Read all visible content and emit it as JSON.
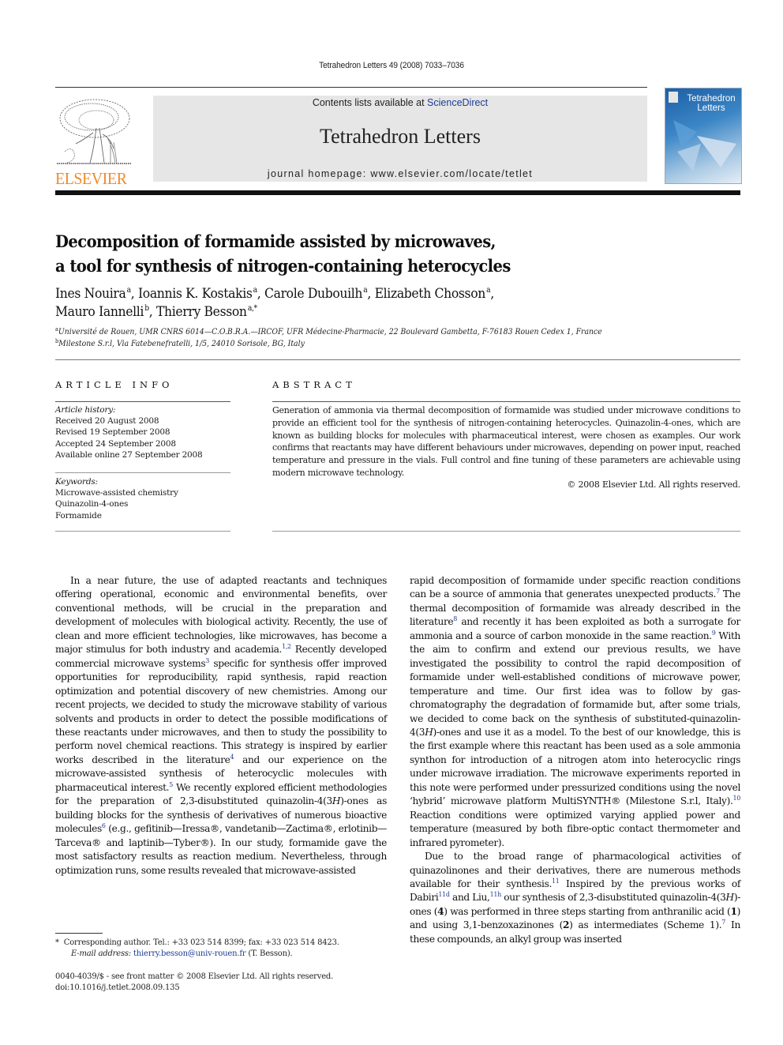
{
  "running_head": "Tetrahedron Letters 49 (2008) 7033–7036",
  "masthead": {
    "publisher_logo_text": "ELSEVIER",
    "contents_prefix": "Contents lists available at ",
    "contents_link": "ScienceDirect",
    "journal_title": "Tetrahedron Letters",
    "homepage": "journal homepage: www.elsevier.com/locate/tetlet",
    "cover_title_line1": "Tetrahedron",
    "cover_title_line2": "Letters",
    "colors": {
      "link_blue": "#1e3c96",
      "elsevier_orange": "#f08a2a",
      "banner_gray": "#e6e6e6"
    }
  },
  "article": {
    "title_line1": "Decomposition of formamide assisted by microwaves,",
    "title_line2": "a tool for synthesis of nitrogen-containing heterocycles",
    "authors": [
      {
        "name": "Ines Nouira",
        "affil": "a",
        "sep": ", "
      },
      {
        "name": "Ioannis K. Kostakis",
        "affil": "a",
        "sep": ", "
      },
      {
        "name": "Carole Dubouilh",
        "affil": "a",
        "sep": ", "
      },
      {
        "name": "Elizabeth Chosson",
        "affil": "a",
        "sep": ","
      },
      {
        "name": "Mauro Iannelli",
        "affil": "b",
        "sep": ", "
      },
      {
        "name": "Thierry Besson",
        "affil": "a,*",
        "sep": ""
      }
    ],
    "affiliations": [
      {
        "mark": "a",
        "text": "Université de Rouen, UMR CNRS 6014—C.O.B.R.A.—IRCOF, UFR Médecine-Pharmacie, 22 Boulevard Gambetta, F-76183 Rouen Cedex 1, France"
      },
      {
        "mark": "b",
        "text": "Milestone S.r.l, Via Fatebenefratelli, 1/5, 24010 Sorisole, BG, Italy"
      }
    ]
  },
  "article_info": {
    "heading": "ARTICLE INFO",
    "history_label": "Article history:",
    "history": [
      "Received 20 August 2008",
      "Revised 19 September 2008",
      "Accepted 24 September 2008",
      "Available online 27 September 2008"
    ],
    "keywords_label": "Keywords:",
    "keywords": [
      "Microwave-assisted chemistry",
      "Quinazolin-4-ones",
      "Formamide"
    ]
  },
  "abstract": {
    "heading": "ABSTRACT",
    "text": "Generation of ammonia via thermal decomposition of formamide was studied under microwave conditions to provide an efficient tool for the synthesis of nitrogen-containing heterocycles. Quinazolin-4-ones, which are known as building blocks for molecules with pharmaceutical interest, were chosen as examples. Our work confirms that reactants may have different behaviours under microwaves, depending on power input, reached temperature and pressure in the vials. Full control and fine tuning of these parameters are achievable using modern microwave technology.",
    "copyright": "© 2008 Elsevier Ltd. All rights reserved."
  },
  "body": {
    "left_col": {
      "p1_a": "In a near future, the use of adapted reactants and techniques offering operational, economic and environmental benefits, over conventional methods, will be crucial in the preparation and development of molecules with biological activity. Recently, the use of clean and more efficient technologies, like microwaves, has become a major stimulus for both industry and academia.",
      "ref_1": "1,2",
      "p1_b": " Recently developed commercial microwave systems",
      "ref_2": "3",
      "p1_c": " specific for synthesis offer improved opportunities for reproducibility, rapid synthesis, rapid reaction optimization and potential discovery of new chemistries. Among our recent projects, we decided to study the microwave stability of various solvents and products in order to detect the possible modifications of these reactants under microwaves, and then to study the possibility to perform novel chemical reactions. This strategy is inspired by earlier works described in the literature",
      "ref_3": "4",
      "p1_d": " and our experience on the microwave-assisted synthesis of heterocyclic molecules with pharmaceutical interest.",
      "ref_4": "5",
      "p1_e": " We recently explored efficient methodologies for the preparation of 2,3-disubstituted quinazolin-4(3",
      "italic_H1": "H",
      "p1_f": ")-ones as building blocks for the synthesis of derivatives of numerous bioactive molecules",
      "ref_5": "6",
      "p1_g": " (e.g., gefitinib—Iressa®, vandetanib—Zactima®, erlotinib—Tarceva® and laptinib—Tyber®). In our study, formamide gave the most satisfactory results as reaction medium. Nevertheless, through optimization runs, some results revealed that microwave-assisted"
    },
    "right_col": {
      "p1_a": "rapid decomposition of formamide under specific reaction conditions can be a source of ammonia that generates unexpected products.",
      "ref_1": "7",
      "p1_b": " The thermal decomposition of formamide was already described in the literature",
      "ref_2": "8",
      "p1_c": " and recently it has been exploited as both a surrogate for ammonia and a source of carbon monoxide in the same reaction.",
      "ref_3": "9",
      "p1_d": " With the aim to confirm and extend our previous results, we have investigated the possibility to control the rapid decomposition of formamide under well-established conditions of microwave power, temperature and time. Our first idea was to follow by gas-chromatography the degradation of formamide but, after some trials, we decided to come back on the synthesis of substituted-quinazolin-4(3",
      "italic_H1": "H",
      "p1_e": ")-ones and use it as a model. To the best of our knowledge, this is the first example where this reactant has been used as a sole ammonia synthon for introduction of a nitrogen atom into heterocyclic rings under microwave irradiation. The microwave experiments reported in this note were performed under pressurized conditions using the novel ‘hybrid’ microwave platform MultiSYNTH® (Milestone S.r.l, Italy).",
      "ref_4": "10",
      "p1_f": " Reaction conditions were optimized varying applied power and temperature (measured by both fibre-optic contact thermometer and infrared pyrometer).",
      "p2_a": "Due to the broad range of pharmacological activities of quinazolinones and their derivatives, there are numerous methods available for their synthesis.",
      "ref_5": "11",
      "p2_b": " Inspired by the previous works of Dabiri",
      "ref_6": "11d",
      "p2_c": " and Liu,",
      "ref_7": "11h",
      "p2_d": " our synthesis of 2,3-disubstituted quinazolin-4(3",
      "italic_H2": "H",
      "p2_e": ")-ones (",
      "bold_4": "4",
      "p2_f": ") was performed in three steps starting from anthranilic acid (",
      "bold_1": "1",
      "p2_g": ") and using 3,1-benzoxazinones (",
      "bold_2": "2",
      "p2_h": ") as intermediates (Scheme 1).",
      "ref_8": "7",
      "p2_i": " In these compounds, an alkyl group was inserted"
    }
  },
  "footnote": {
    "star": "*",
    "corresponding": "Corresponding author. Tel.: +33 023 514 8399; fax: +33 023 514 8423.",
    "email_label": "E-mail address:",
    "email": "thierry.besson@univ-rouen.fr",
    "email_suffix": " (T. Besson)."
  },
  "bottom": {
    "issn": "0040-4039/$ - see front matter © 2008 Elsevier Ltd. All rights reserved.",
    "doi": "doi:10.1016/j.tetlet.2008.09.135"
  }
}
